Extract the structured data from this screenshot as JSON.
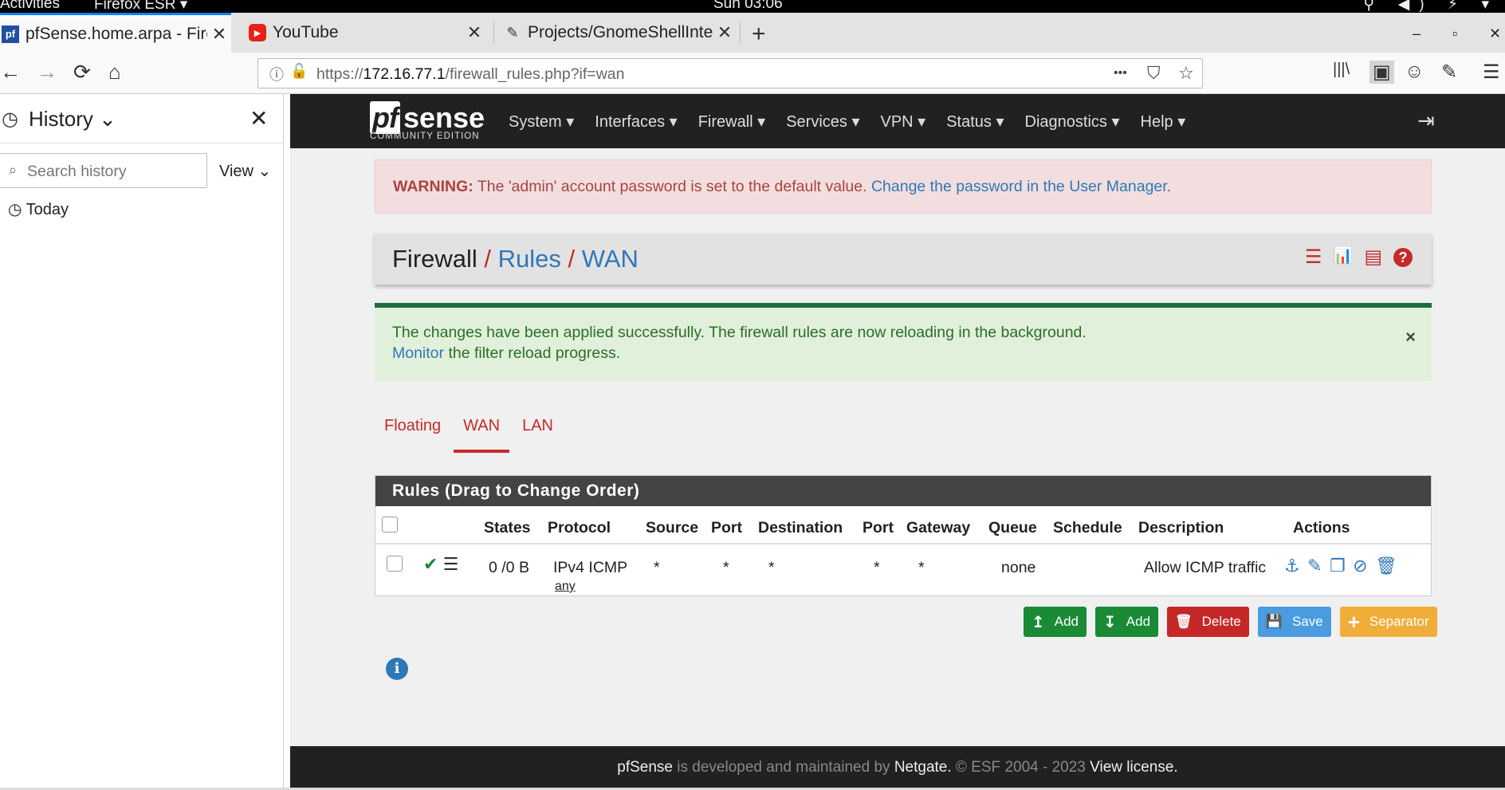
{
  "gnome": {
    "activities": "Activities",
    "app_menu": "Firefox ESR ▾",
    "clock": "Sun 03:06",
    "tray": "⚲ ◀) ⚡ ▾"
  },
  "tabs": [
    {
      "title": "pfSense.home.arpa - Fire",
      "favicon": "pf"
    },
    {
      "title": "YouTube",
      "favicon": "▶"
    },
    {
      "title": "Projects/GnomeShellInte",
      "favicon": "✎"
    }
  ],
  "tab_close": "✕",
  "new_tab": "+",
  "window": {
    "minimize": "–",
    "maximize": "▫",
    "close": "✕"
  },
  "nav": {
    "back": "←",
    "forward": "→",
    "reload": "⟳",
    "home": "⌂",
    "url_prefix": "https://",
    "url_host": "172.16.77.1",
    "url_path": "/firewall_rules.php?if=wan",
    "more": "•••",
    "pocket": "⛉",
    "star": "☆",
    "library": "|||\\",
    "sidebar": "▣",
    "account": "☺",
    "ext": "✎",
    "menu": "☰"
  },
  "history": {
    "icon": "◷",
    "title": "History ⌄",
    "close": "✕",
    "search_placeholder": "Search history",
    "view_label": "View ⌄",
    "today": "◷ Today"
  },
  "pfsense": {
    "logo_pf": "pf",
    "logo_sense": "sense",
    "edition": "COMMUNITY EDITION",
    "menu": [
      "System ▾",
      "Interfaces ▾",
      "Firewall ▾",
      "Services ▾",
      "VPN ▾",
      "Status ▾",
      "Diagnostics ▾",
      "Help ▾"
    ],
    "logout": "⇥",
    "warning": {
      "strong": "WARNING:",
      "text": " The 'admin' account password is set to the default value. ",
      "link": "Change the password in the User Manager."
    },
    "breadcrumb": {
      "root": "Firewall",
      "sep": " / ",
      "rules": "Rules",
      "wan": "WAN"
    },
    "crumb_icons": [
      "☰",
      "📊",
      "▤",
      "?"
    ],
    "success": {
      "line1": "The changes have been applied successfully. The firewall rules are now reloading in the background.",
      "link": "Monitor",
      "line2": " the filter reload progress.",
      "close": "×"
    },
    "iftabs": [
      "Floating",
      "WAN",
      "LAN"
    ],
    "panel_title": "Rules (Drag to Change Order)",
    "columns": [
      "States",
      "Protocol",
      "Source",
      "Port",
      "Destination",
      "Port",
      "Gateway",
      "Queue",
      "Schedule",
      "Description",
      "Actions"
    ],
    "rule": {
      "status_icons": "✔ ☰",
      "states": "0 /0 B",
      "protocol": "IPv4 ICMP",
      "protocol_sub": "any",
      "source": "*",
      "source_port": "*",
      "destination": "*",
      "dest_port": "*",
      "gateway": "*",
      "queue": "none",
      "schedule": "",
      "description": "Allow ICMP traffic",
      "actions": [
        "⚓",
        "✎",
        "❐",
        "⊘",
        "🗑"
      ]
    },
    "buttons": [
      {
        "icon": "↥",
        "label": "Add"
      },
      {
        "icon": "↧",
        "label": "Add"
      },
      {
        "icon": "🗑",
        "label": "Delete"
      },
      {
        "icon": "💾",
        "label": "Save"
      },
      {
        "icon": "+",
        "label": "Separator"
      }
    ],
    "info_icon": "i",
    "footer": {
      "brand": "pfSense",
      "mid": " is developed and maintained by ",
      "company": "Netgate.",
      "copy": " © ESF 2004 - 2023 ",
      "license": "View license."
    }
  }
}
